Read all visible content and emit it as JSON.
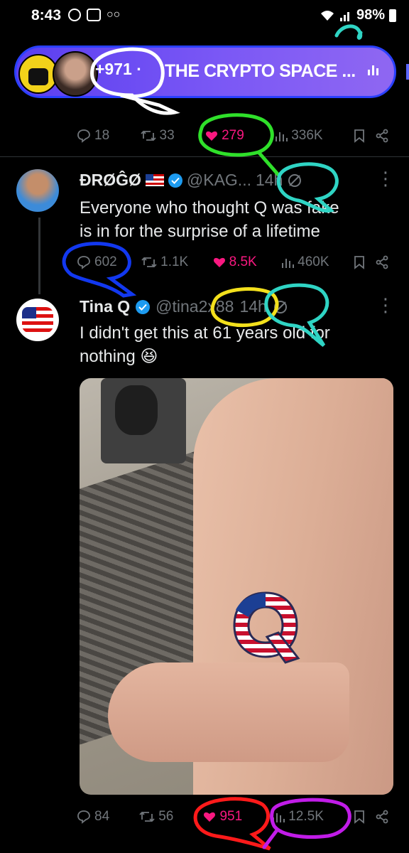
{
  "status": {
    "time": "8:43",
    "battery": "98%"
  },
  "space": {
    "count": "+971",
    "separator": "·",
    "title": "THE CRYPTO SPACE ..."
  },
  "prev_actions": {
    "replies": "18",
    "reposts": "33",
    "likes": "279",
    "views": "336K"
  },
  "tweet1": {
    "name": "ĐRØĜØ",
    "handle": "@KAG...",
    "time": "14h",
    "text_line1": "Everyone who thought Q was fake",
    "text_line2": "is in for the surprise of a lifetime",
    "actions": {
      "replies": "602",
      "reposts": "1.1K",
      "likes": "8.5K",
      "views": "460K"
    }
  },
  "tweet2": {
    "name": "Tina Q",
    "handle": "@tina2x88",
    "time": "14h",
    "text_line1": "I didn't get this at 61 years old for",
    "text_line2": "nothing 😆",
    "actions": {
      "replies": "84",
      "reposts": "56",
      "likes": "951",
      "views": "12.5K"
    }
  },
  "colors": {
    "background": "#000000",
    "accent": "#1d9bf0",
    "like": "#f91880",
    "muted": "#71767b",
    "space_gradient_start": "#5b3ff0",
    "space_gradient_end": "#8f67f2"
  },
  "icons": [
    "reply-icon",
    "repost-icon",
    "heart-icon",
    "views-icon",
    "bookmark-icon",
    "share-icon",
    "verified-icon",
    "more-icon",
    "grok-icon"
  ]
}
